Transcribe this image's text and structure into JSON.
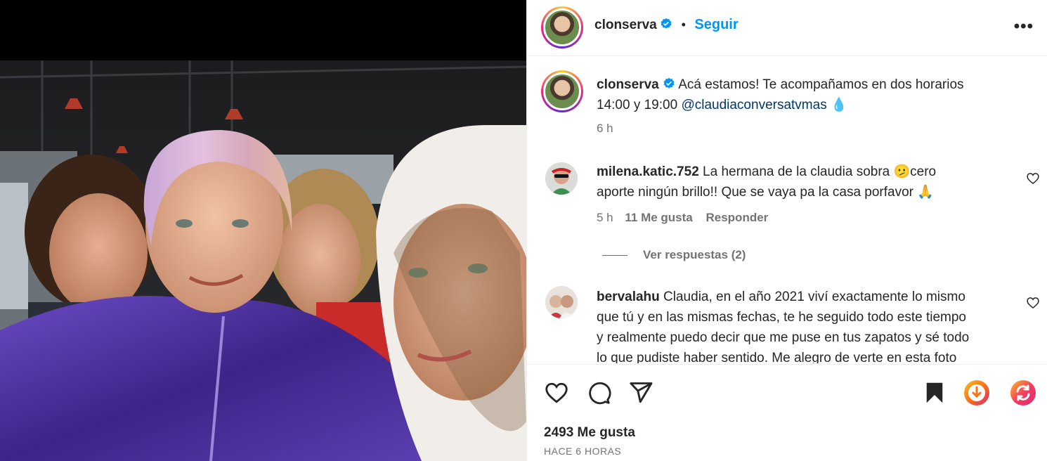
{
  "post": {
    "author": "clonserva",
    "follow_label": "Seguir",
    "more_label": "•••",
    "caption_line1": "Acá estamos! Te acompañamos en dos horarios",
    "caption_line2_pre": "14:00 y 19:00 ",
    "caption_mention": "@claudiaconversatvmas",
    "caption_emoji": "💧",
    "caption_time": "6 h",
    "likes": "2493 Me gusta",
    "time_ago": "HACE 6 HORAS"
  },
  "comments": [
    {
      "user": "milena.katic.752",
      "line1": "La hermana de la claudia sobra 🫤cero",
      "line2": "aporte ningún brillo!! Que se vaya pa la casa porfavor 🙏",
      "time": "5 h",
      "likes": "11 Me gusta",
      "reply": "Responder",
      "view_replies": "Ver respuestas (2)"
    },
    {
      "user": "bervalahu",
      "line1": "Claudia, en el año 2021 viví exactamente lo mismo",
      "line2": "que tú y en las mismas fechas, te he seguido todo este tiempo",
      "line3": "y realmente puedo decir que me puse en tus zapatos y sé todo",
      "line4": "lo que pudiste haber sentido. Me alegro de verte en esta foto"
    }
  ],
  "colors": {
    "link_blue": "#0095f6",
    "mention_blue": "#00376b",
    "verified_blue": "#0095f6",
    "muted": "#737373",
    "jacket_purple": "#4b2a8f"
  },
  "icons": [
    "heart-icon",
    "comment-icon",
    "share-icon",
    "bookmark-icon",
    "download-icon",
    "refresh-icon",
    "verified-icon",
    "more-icon"
  ]
}
